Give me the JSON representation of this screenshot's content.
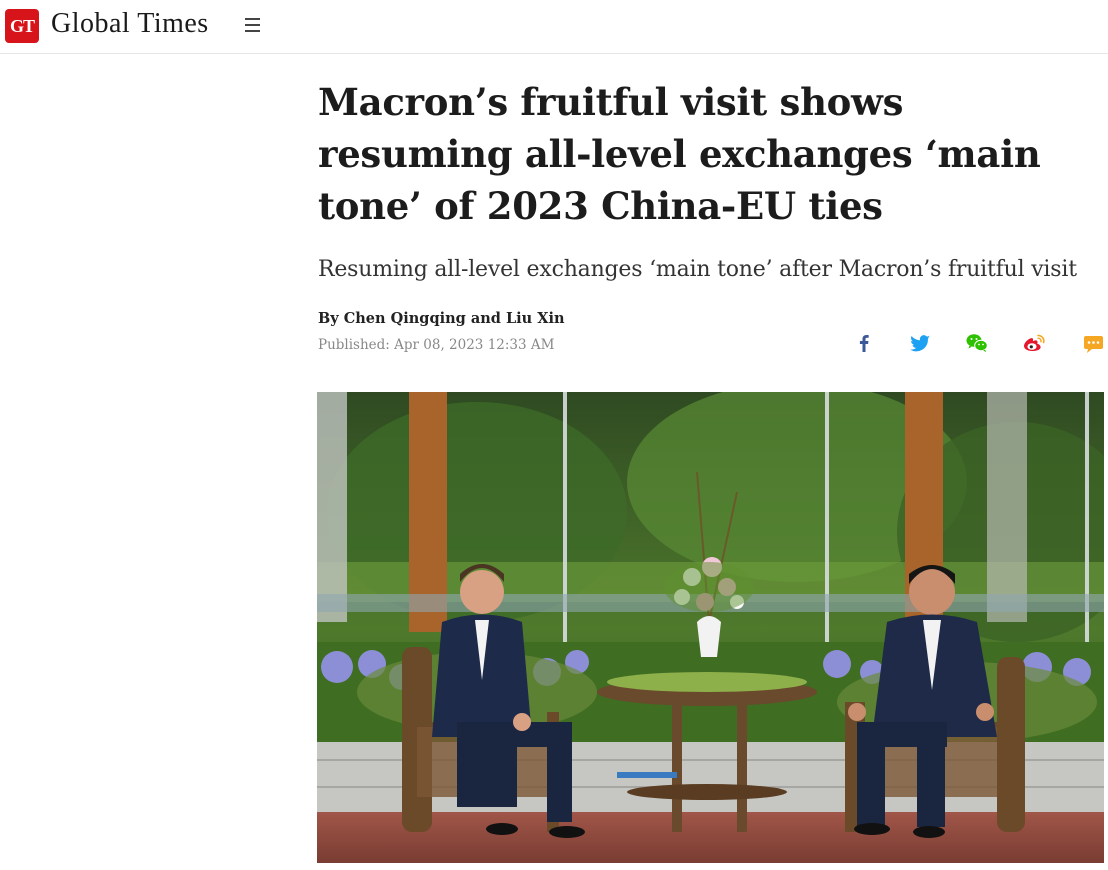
{
  "header": {
    "logo_text": "GT",
    "brand": "Global Times",
    "menu_icon": "hamburger-menu-icon"
  },
  "article": {
    "headline": "Macron’s fruitful visit shows resuming all-level exchanges ‘main tone’ of 2023 China-EU ties",
    "subhead": "Resuming all-level exchanges ‘main tone’ after Macron’s fruitful visit",
    "byline": "By Chen Qingqing and Liu Xin",
    "published": "Published: Apr 08, 2023 12:33 AM"
  },
  "share": {
    "icons": [
      "facebook-icon",
      "twitter-icon",
      "wechat-icon",
      "weibo-icon",
      "comment-icon"
    ]
  },
  "colors": {
    "brand_red": "#d7141a",
    "facebook": "#3b5998",
    "twitter": "#1da1f2",
    "wechat": "#2dc100",
    "weibo": "#e6162d",
    "comment": "#f5a623"
  }
}
